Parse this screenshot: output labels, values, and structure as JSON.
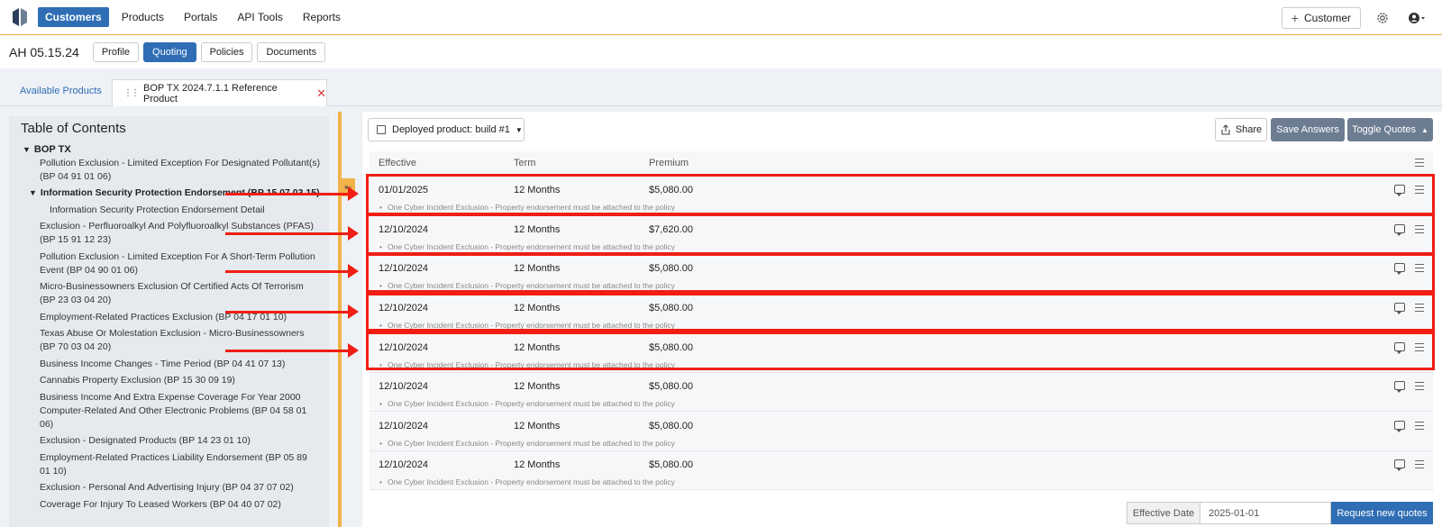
{
  "nav": {
    "items": [
      "Customers",
      "Products",
      "Portals",
      "API Tools",
      "Reports"
    ],
    "customer_button": "Customer",
    "accent": "#2f6eb5"
  },
  "entity": {
    "title": "AH 05.15.24",
    "tabs": [
      "Profile",
      "Quoting",
      "Policies",
      "Documents"
    ]
  },
  "product_tabs": {
    "available": "Available Products",
    "open_tab": "BOP TX 2024.7.1.1 Reference Product"
  },
  "toc": {
    "title": "Table of Contents",
    "root": "BOP TX",
    "items": [
      "Pollution Exclusion - Limited Exception For Designated Pollutant(s)",
      "(BP 04 91 01 06)",
      "Information Security Protection Endorsement (BP 15 07 03 15)",
      "Information Security Protection Endorsement Detail",
      "Exclusion - Perfluoroalkyl And Polyfluoroalkyl Substances (PFAS)",
      "(BP 15 91 12 23)",
      "Pollution Exclusion - Limited Exception For A Short-Term Pollution",
      "Event (BP 04 90 01 06)",
      "Micro-Businessowners Exclusion Of Certified Acts Of Terrorism",
      "(BP 23 03 04 20)",
      "Employment-Related Practices Exclusion (BP 04 17 01 10)",
      "Texas Abuse Or Molestation Exclusion - Micro-Businessowners",
      "(BP 70 03 04 20)",
      "Business Income Changes - Time Period (BP 04 41 07 13)",
      "Cannabis Property Exclusion (BP 15 30 09 19)",
      "Business Income And Extra Expense Coverage For Year 2000",
      "Computer-Related And Other Electronic Problems (BP 04 58 01",
      "06)",
      "Exclusion - Designated Products (BP 14 23 01 10)",
      "Employment-Related Practices Liability Endorsement (BP 05 89",
      "01 10)",
      "Exclusion - Personal And Advertising Injury (BP 04 37 07 02)",
      "Coverage For Injury To Leased Workers (BP 04 40 07 02)"
    ]
  },
  "toolbar": {
    "deployed": "Deployed product: build #1",
    "share": "Share",
    "save": "Save Answers",
    "toggle": "Toggle Quotes"
  },
  "table": {
    "headers": [
      "Effective",
      "Term",
      "Premium"
    ],
    "note": "One Cyber Incident Exclusion - Property endorsement must be attached to the policy",
    "rows": [
      {
        "effective": "01/01/2025",
        "term": "12 Months",
        "premium": "$5,080.00"
      },
      {
        "effective": "12/10/2024",
        "term": "12 Months",
        "premium": "$7,620.00"
      },
      {
        "effective": "12/10/2024",
        "term": "12 Months",
        "premium": "$5,080.00"
      },
      {
        "effective": "12/10/2024",
        "term": "12 Months",
        "premium": "$5,080.00"
      },
      {
        "effective": "12/10/2024",
        "term": "12 Months",
        "premium": "$5,080.00"
      },
      {
        "effective": "12/10/2024",
        "term": "12 Months",
        "premium": "$5,080.00"
      },
      {
        "effective": "12/10/2024",
        "term": "12 Months",
        "premium": "$5,080.00"
      },
      {
        "effective": "12/10/2024",
        "term": "12 Months",
        "premium": "$5,080.00"
      }
    ]
  },
  "footer": {
    "effective_label": "Effective Date",
    "effective_value": "2025-01-01",
    "request_button": "Request new quotes"
  },
  "annotation_color": "#f01e14"
}
